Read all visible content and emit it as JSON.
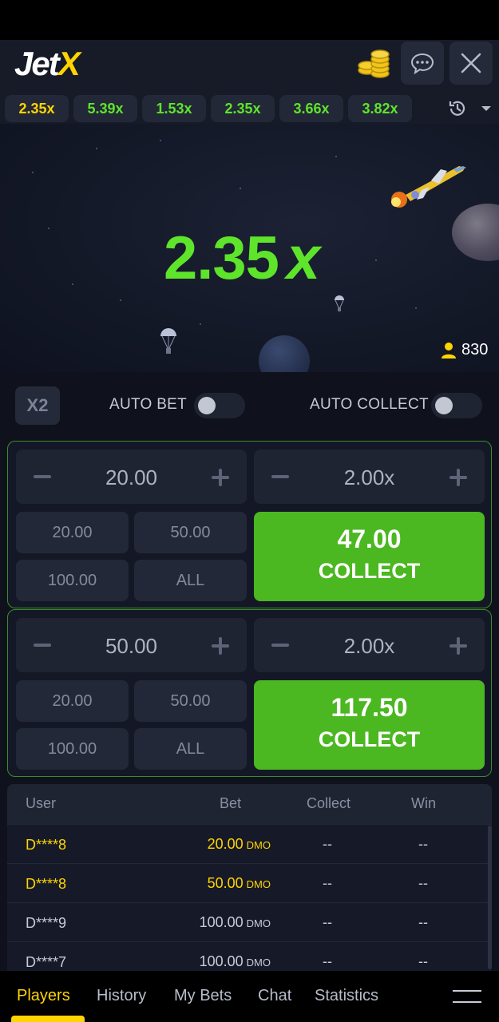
{
  "header": {
    "logo_main": "Jet",
    "logo_accent": "X"
  },
  "multipliers": [
    {
      "value": "2.35x",
      "color": "yellow"
    },
    {
      "value": "5.39x",
      "color": "green"
    },
    {
      "value": "1.53x",
      "color": "green"
    },
    {
      "value": "2.35x",
      "color": "green"
    },
    {
      "value": "3.66x",
      "color": "green"
    },
    {
      "value": "3.82x",
      "color": "green"
    }
  ],
  "game": {
    "multiplier": "2.35",
    "multiplier_suffix": "x",
    "players_online": "830"
  },
  "controls": {
    "x2": "X2",
    "auto_bet": "AUTO BET",
    "auto_collect": "AUTO COLLECT"
  },
  "bets": [
    {
      "amount": "20.00",
      "cashout": "2.00x",
      "quick": [
        "20.00",
        "50.00",
        "100.00",
        "ALL"
      ],
      "collect_amount": "47.00",
      "collect_label": "COLLECT"
    },
    {
      "amount": "50.00",
      "cashout": "2.00x",
      "quick": [
        "20.00",
        "50.00",
        "100.00",
        "ALL"
      ],
      "collect_amount": "117.50",
      "collect_label": "COLLECT"
    }
  ],
  "table": {
    "headers": {
      "user": "User",
      "bet": "Bet",
      "collect": "Collect",
      "win": "Win"
    },
    "rows": [
      {
        "user": "D****8",
        "bet": "20.00",
        "currency": "DMO",
        "collect": "--",
        "win": "--",
        "highlight": true
      },
      {
        "user": "D****8",
        "bet": "50.00",
        "currency": "DMO",
        "collect": "--",
        "win": "--",
        "highlight": true
      },
      {
        "user": "D****9",
        "bet": "100.00",
        "currency": "DMO",
        "collect": "--",
        "win": "--",
        "highlight": false
      },
      {
        "user": "D****7",
        "bet": "100.00",
        "currency": "DMO",
        "collect": "--",
        "win": "--",
        "highlight": false
      }
    ]
  },
  "nav": {
    "players": "Players",
    "history": "History",
    "my_bets": "My Bets",
    "chat": "Chat",
    "statistics": "Statistics"
  },
  "colors": {
    "accent_green": "#4bb721",
    "multiplier_green": "#5ee42a",
    "accent_yellow": "#ffd400"
  },
  "icons": [
    "coins-icon",
    "chat-icon",
    "close-icon",
    "history-icon",
    "chevron-down-icon",
    "user-icon",
    "hamburger-menu-icon"
  ]
}
